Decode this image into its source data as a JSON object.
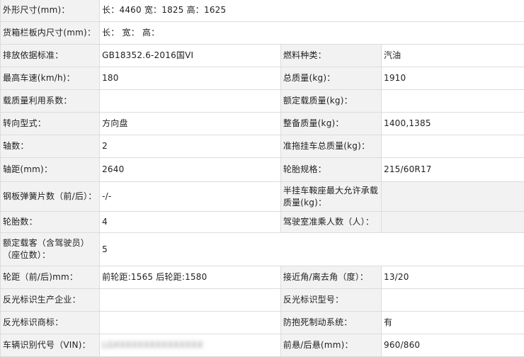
{
  "rows": [
    {
      "l1": "外形尺寸(mm)：",
      "v1": "长：4460 宽：1825 高：1625"
    },
    {
      "l1": "货箱栏板内尺寸(mm)：",
      "v1": "长： 宽： 高："
    },
    {
      "l1": "排放依据标准：",
      "v1": "GB18352.6-2016国VI",
      "l2": "燃料种类：",
      "v2": "汽油"
    },
    {
      "l1": "最高车速(km/h)：",
      "v1": "180",
      "l2": "总质量(kg)：",
      "v2": "1910"
    },
    {
      "l1": "载质量利用系数：",
      "v1": "",
      "l2": "额定载质量(kg)：",
      "v2": ""
    },
    {
      "l1": "转向型式：",
      "v1": "方向盘",
      "l2": "整备质量(kg)：",
      "v2": "1400,1385"
    },
    {
      "l1": "轴数：",
      "v1": "2",
      "l2": "准拖挂车总质量(kg)：",
      "v2": ""
    },
    {
      "l1": "轴距(mm)：",
      "v1": "2640",
      "l2": "轮胎规格：",
      "v2": "215/60R17"
    },
    {
      "l1": "钢板弹簧片数（前/后）：",
      "v1": "-/-",
      "l2": "半挂车鞍座最大允许承载质量(kg)：",
      "v2": ""
    },
    {
      "l1": "轮胎数：",
      "v1": "4",
      "l2": "驾驶室准乘人数（人）：",
      "v2": ""
    },
    {
      "l1": "额定载客（含驾驶员）（座位数）：",
      "v1": "5"
    },
    {
      "l1": "轮距（前/后)mm：",
      "v1": "前轮距:1565 后轮距:1580",
      "l2": "接近角/离去角（度）：",
      "v2": "13/20"
    },
    {
      "l1": "反光标识生产企业：",
      "v1": "",
      "l2": "反光标识型号：",
      "v2": ""
    },
    {
      "l1": "反光标识商标：",
      "v1": "",
      "l2": "防抱死制动系统：",
      "v2": "有"
    },
    {
      "l1": "车辆识别代号（VIN)：",
      "v1": "LGXXXXXXXXXXXXXXX",
      "l2": "前悬/后悬(mm)：",
      "v2": "960/860"
    }
  ]
}
